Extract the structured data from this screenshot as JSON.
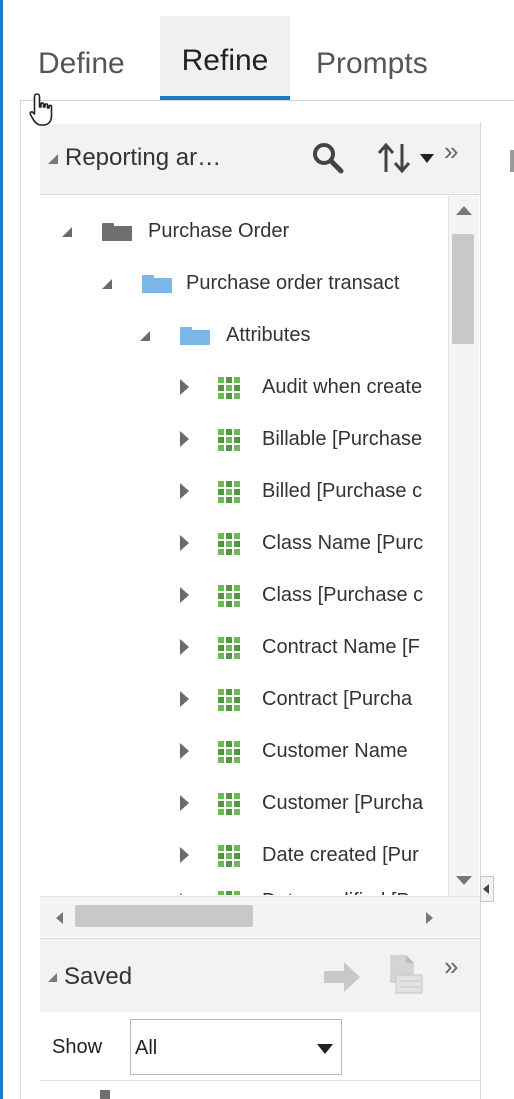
{
  "tabs": [
    {
      "label": "Define"
    },
    {
      "label": "Refine",
      "active": true
    },
    {
      "label": "Prompts"
    }
  ],
  "reporting_area": {
    "title": "Reporting ar…",
    "more": "»"
  },
  "tree": {
    "root": "Purchase Order",
    "child": "Purchase order transact",
    "group": "Attributes",
    "items": [
      "Audit when create",
      "Billable [Purchase",
      "Billed [Purchase c",
      "Class Name [Purc",
      "Class [Purchase c",
      "Contract Name [F",
      "Contract [Purcha",
      "Customer Name",
      "Customer [Purcha",
      "Date created [Pur",
      "Date modified [Pu"
    ]
  },
  "saved": {
    "title": "Saved",
    "more": "»",
    "show_label": "Show",
    "show_value": "All"
  },
  "colors": {
    "accent": "#1a7ac4",
    "folder_dark": "#6f6f6f",
    "folder_blue": "#7ab8e8",
    "attribute_icon": "#4c9a3c"
  }
}
